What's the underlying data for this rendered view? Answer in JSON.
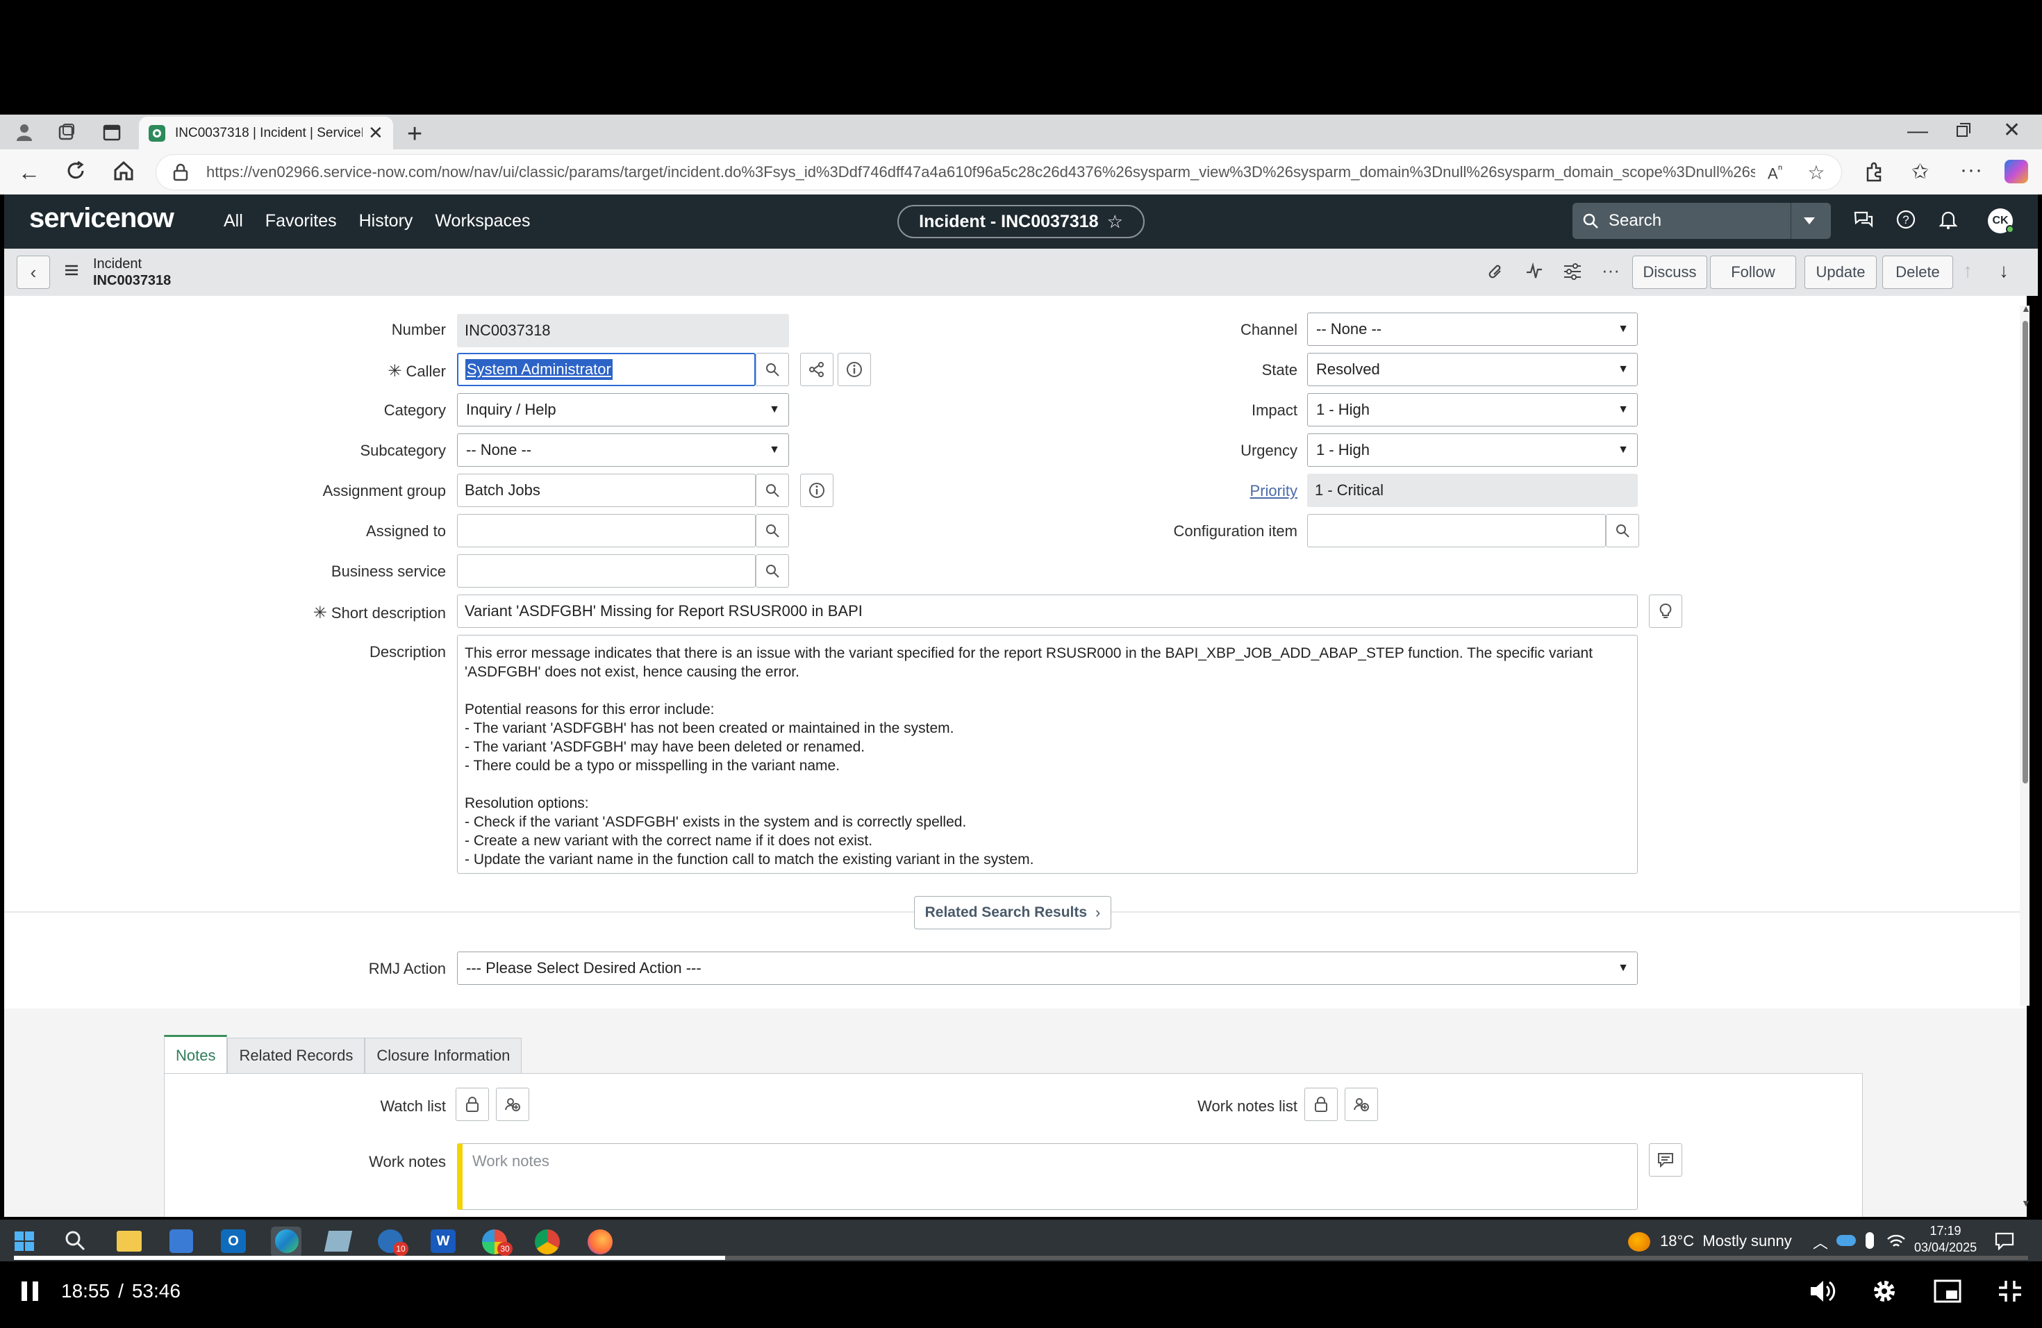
{
  "browser": {
    "tab_title": "INC0037318 | Incident | ServiceN",
    "url": "https://ven02966.service-now.com/now/nav/ui/classic/params/target/incident.do%3Fsys_id%3Ddf746dff47a4a610f96a5c28c26d4376%26sysparm_view%3D%26sysparm_domain%3Dnull%26sysparm_domain_scope%3Dnull%26sysparm..."
  },
  "header": {
    "logo": "servicenow",
    "nav": [
      "All",
      "Favorites",
      "History",
      "Workspaces"
    ],
    "record_title": "Incident - INC0037318",
    "search_placeholder": "Search",
    "avatar": "CK"
  },
  "form_header": {
    "table": "Incident",
    "number": "INC0037318",
    "buttons": {
      "discuss": "Discuss",
      "follow": "Follow",
      "update": "Update",
      "delete": "Delete"
    }
  },
  "fields": {
    "number": {
      "label": "Number",
      "value": "INC0037318"
    },
    "caller": {
      "label": "Caller",
      "value": "System Administrator"
    },
    "category": {
      "label": "Category",
      "value": "Inquiry / Help"
    },
    "subcategory": {
      "label": "Subcategory",
      "value": "-- None --"
    },
    "assignment_group": {
      "label": "Assignment group",
      "value": "Batch Jobs"
    },
    "assigned_to": {
      "label": "Assigned to",
      "value": ""
    },
    "business_service": {
      "label": "Business service",
      "value": ""
    },
    "channel": {
      "label": "Channel",
      "value": "-- None --"
    },
    "state": {
      "label": "State",
      "value": "Resolved"
    },
    "impact": {
      "label": "Impact",
      "value": "1 - High"
    },
    "urgency": {
      "label": "Urgency",
      "value": "1 - High"
    },
    "priority": {
      "label": "Priority",
      "value": "1 - Critical"
    },
    "configuration_item": {
      "label": "Configuration item",
      "value": ""
    },
    "short_description": {
      "label": "Short description",
      "value": "Variant 'ASDFGBH' Missing for Report RSUSR000 in BAPI"
    },
    "description": {
      "label": "Description",
      "lines": [
        "This error message indicates that there is an issue with the variant specified for the report RSUSR000 in the BAPI_XBP_JOB_ADD_ABAP_STEP function. The specific variant",
        "'ASDFGBH' does not exist, hence causing the error.",
        "",
        "Potential reasons for this error include:",
        "- The variant 'ASDFGBH' has not been created or maintained in the system.",
        "- The variant 'ASDFGBH' may have been deleted or renamed.",
        "- There could be a typo or misspelling in the variant name.",
        "",
        "Resolution options:",
        "- Check if the variant 'ASDFGBH' exists in the system and is correctly spelled.",
        "- Create a new variant with the correct name if it does not exist.",
        "- Update the variant name in the function call to match the existing variant in the system."
      ]
    },
    "related_search": "Related Search Results",
    "rmj_action": {
      "label": "RMJ Action",
      "value": "--- Please Select Desired Action ---"
    }
  },
  "tabs": [
    "Notes",
    "Related Records",
    "Closure Information"
  ],
  "notes": {
    "watch_list": "Watch list",
    "work_notes_list": "Work notes list",
    "work_notes_label": "Work notes",
    "work_notes_placeholder": "Work notes"
  },
  "taskbar": {
    "weather": "18°C  Mostly sunny",
    "time": "17:19",
    "date": "03/04/2025",
    "badge_mail": "10",
    "badge_app": "30"
  },
  "video": {
    "current": "18:55",
    "separator": "/",
    "total": "53:46",
    "progress": 0.353
  }
}
